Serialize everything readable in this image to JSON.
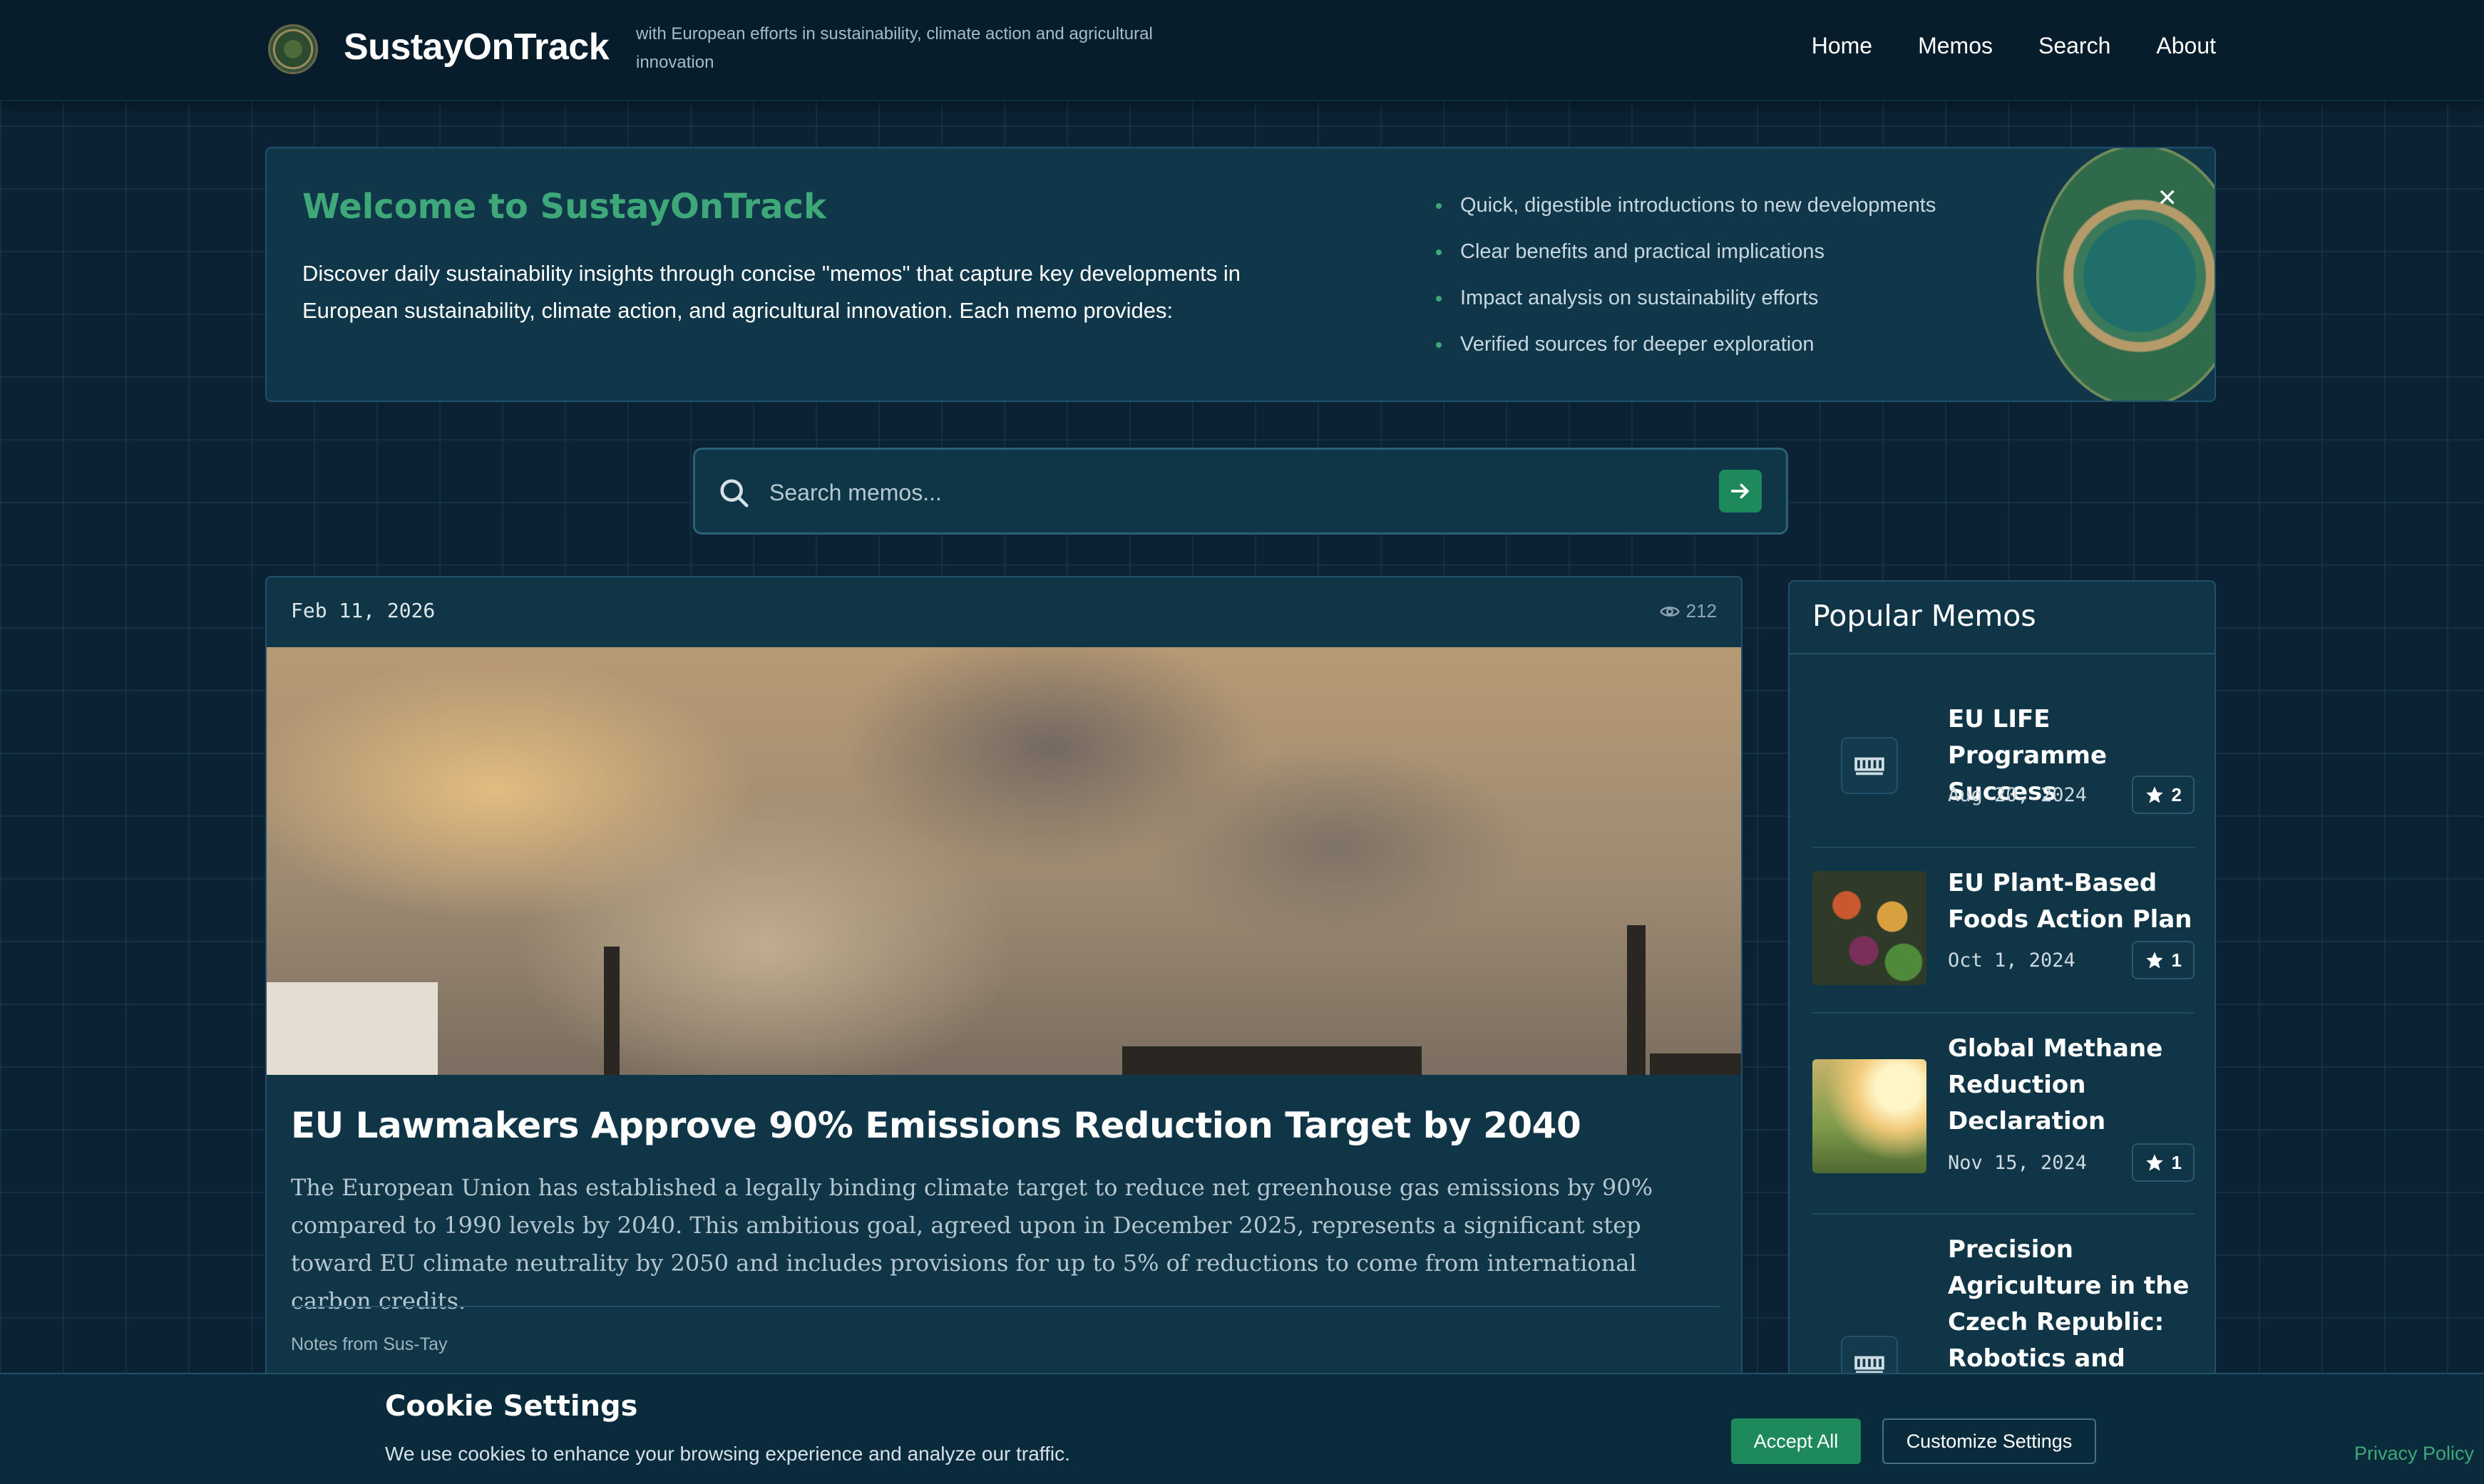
{
  "header": {
    "brand": "SustayOnTrack",
    "tagline": "with European efforts in sustainability, climate action and agricultural innovation",
    "nav": [
      "Home",
      "Memos",
      "Search",
      "About"
    ]
  },
  "welcome": {
    "title": "Welcome to SustayOnTrack",
    "intro": "Discover daily sustainability insights through concise \"memos\" that capture key developments in European sustainability, climate action, and agricultural innovation. Each memo provides:",
    "bullets": [
      "Quick, digestible introductions to new developments",
      "Clear benefits and practical implications",
      "Impact analysis on sustainability efforts",
      "Verified sources for deeper exploration"
    ],
    "close_glyph": "✕"
  },
  "search": {
    "placeholder": "Search memos..."
  },
  "featured": {
    "date": "Feb 11, 2026",
    "views": "212",
    "title": "EU Lawmakers Approve 90% Emissions Reduction Target by 2040",
    "summary": "The European Union has established a legally binding climate target to reduce net greenhouse gas emissions by 90% compared to 1990 levels by 2040. This ambitious goal, agreed upon in December 2025, represents a significant step toward EU climate neutrality by 2050 and includes provisions for up to 5% of reductions to come from international carbon credits.",
    "author": "Notes from Sus-Tay"
  },
  "popular": {
    "heading": "Popular Memos",
    "items": [
      {
        "title": "EU LIFE Programme Success",
        "date": "Aug 20, 2024",
        "stars": "2",
        "thumb": "placeholder"
      },
      {
        "title": "EU Plant-Based Foods Action Plan",
        "date": "Oct 1, 2024",
        "stars": "1",
        "thumb": "vegetables"
      },
      {
        "title": "Global Methane Reduction Declaration",
        "date": "Nov 15, 2024",
        "stars": "1",
        "thumb": "sunlight"
      },
      {
        "title": "Precision Agriculture in the Czech Republic: Robotics and",
        "date": "",
        "stars": "",
        "thumb": "placeholder"
      }
    ]
  },
  "cookie": {
    "title": "Cookie Settings",
    "text": "We use cookies to enhance your browsing experience and analyze our traffic.",
    "accept": "Accept All",
    "customize": "Customize Settings",
    "privacy": "Privacy Policy"
  },
  "colors": {
    "accent": "#3fa878",
    "button": "#1e8a5c",
    "background": "#0a2233",
    "panel": "#0f3547"
  }
}
